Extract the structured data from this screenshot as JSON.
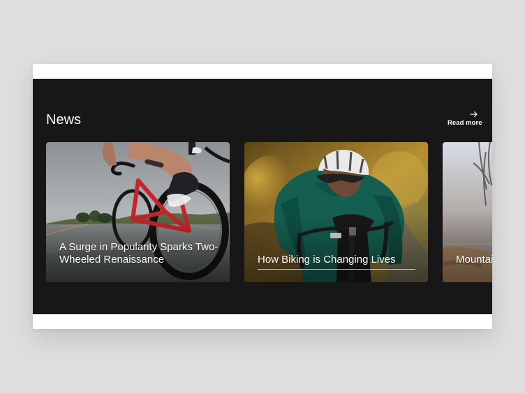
{
  "section": {
    "title": "News",
    "read_more": "Read more"
  },
  "cards": [
    {
      "title": "A Surge in Popularity Sparks Two-Wheeled Renaissance",
      "image": "road-cyclist-close-up-photo"
    },
    {
      "title": "How Biking is Changing Lives",
      "image": "cyclist-in-green-jersey-photo"
    },
    {
      "title": "Mountain Biking Popularity",
      "image": "misty-trail-photo"
    }
  ],
  "colors": {
    "page_background": "#dedede",
    "frame_background": "#ffffff",
    "panel_background": "#171717",
    "text": "#ffffff"
  }
}
